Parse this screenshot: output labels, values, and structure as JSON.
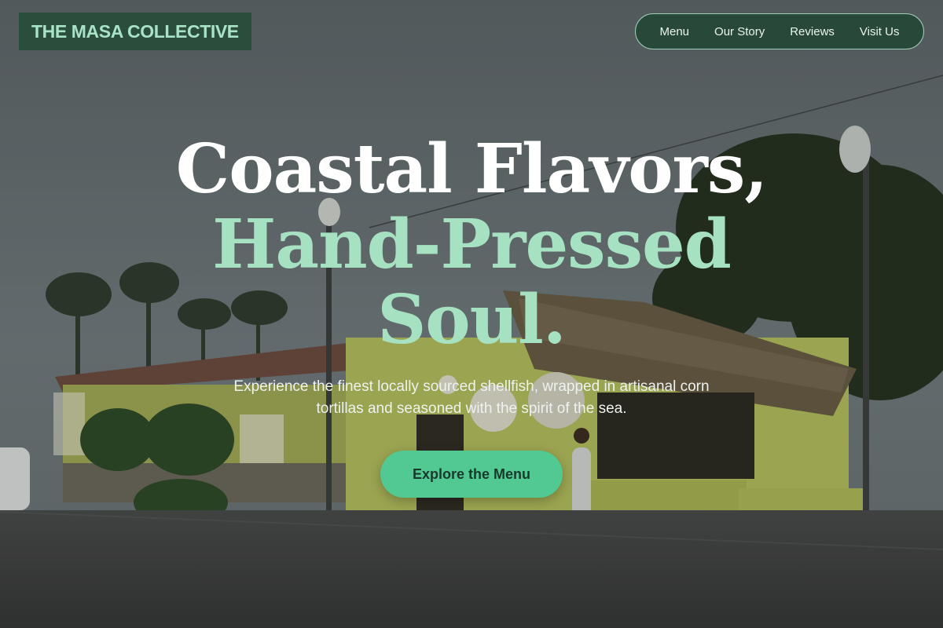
{
  "brand": {
    "name": "THE MASA COLLECTIVE"
  },
  "nav": {
    "items": [
      "Menu",
      "Our Story",
      "Reviews",
      "Visit Us"
    ]
  },
  "hero": {
    "headline_line1": "Coastal Flavors,",
    "headline_line2": "Hand-Pressed",
    "headline_line3": "Soul.",
    "subtitle": "Experience the finest locally sourced shellfish, wrapped in artisanal corn tortillas and seasoned with the spirit of the sea.",
    "cta_label": "Explore the Menu",
    "background": "dusk-photo-of-thatched-roof-taco-stand-with-palm-trees"
  },
  "colors": {
    "accent": "#52c892",
    "accent_light": "#a6e2c2",
    "brand_dark": "#2b4d3c"
  }
}
